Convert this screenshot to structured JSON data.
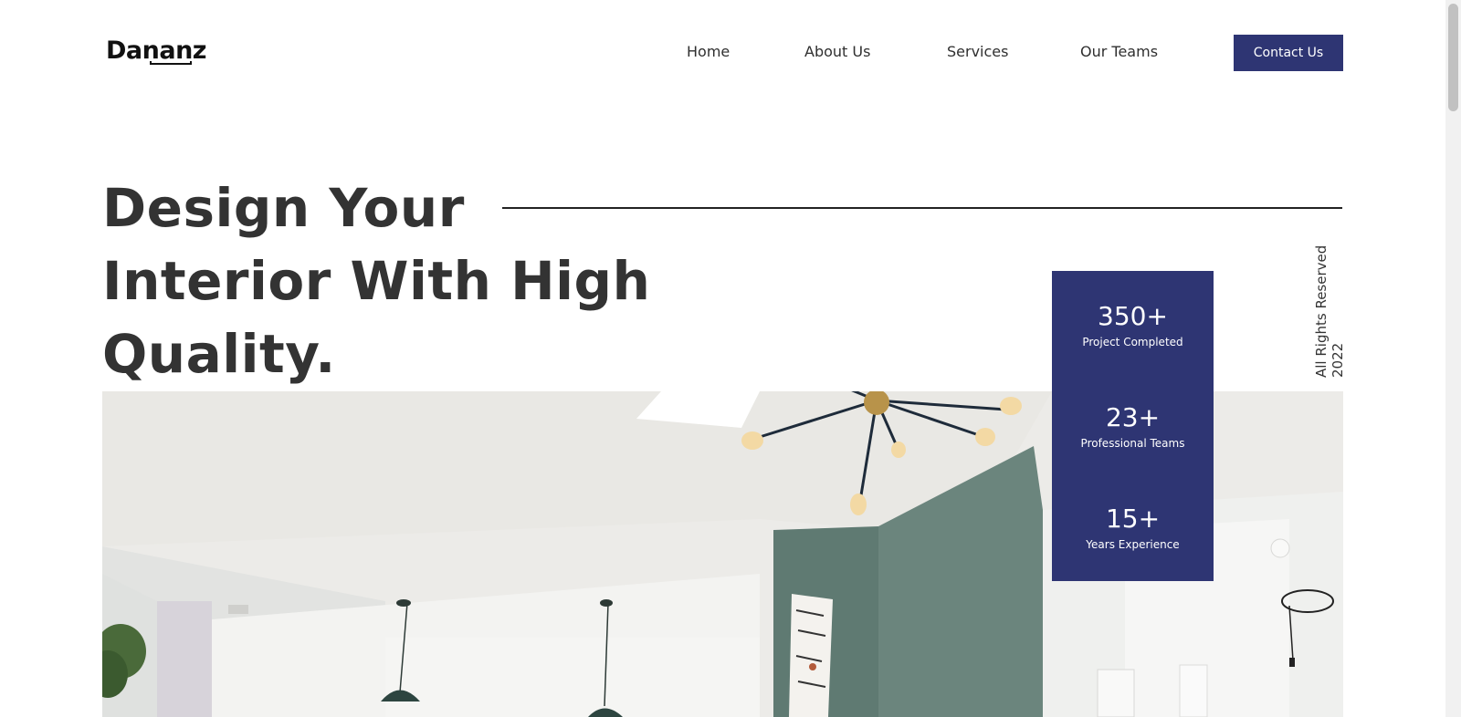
{
  "header": {
    "logo": "Dananz",
    "nav": [
      {
        "label": "Home"
      },
      {
        "label": "About Us"
      },
      {
        "label": "Services"
      },
      {
        "label": "Our Teams"
      }
    ],
    "cta_label": "Contact Us"
  },
  "hero": {
    "title_lines": [
      "Design Your",
      "Interior With High",
      "Quality."
    ],
    "side_text_year": "2022",
    "side_text_rights": "All Rights Reserved"
  },
  "stats": [
    {
      "value": "350+",
      "label": "Project Completed"
    },
    {
      "value": "23+",
      "label": "Professional Teams"
    },
    {
      "value": "15+",
      "label": "Years Experience"
    }
  ],
  "colors": {
    "accent": "#2e3573",
    "text": "#333333",
    "wall_green": "#5f7a72"
  },
  "icons": {
    "photo": "interior-room-photo"
  }
}
